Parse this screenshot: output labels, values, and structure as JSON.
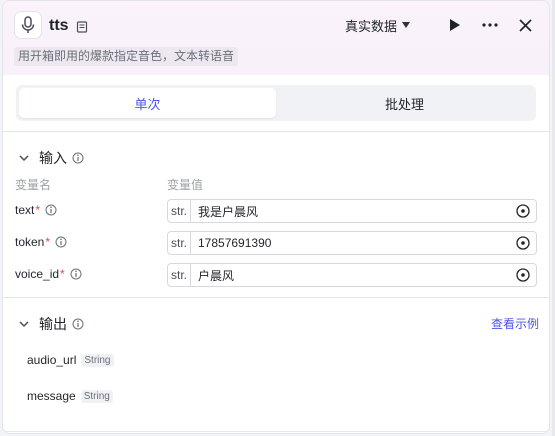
{
  "header": {
    "title": "tts",
    "description": "用开箱即用的爆款指定音色，文本转语音",
    "data_mode": "真实数据"
  },
  "tabs": [
    {
      "label": "单次",
      "active": true
    },
    {
      "label": "批处理",
      "active": false
    }
  ],
  "input_section": {
    "title": "输入",
    "col_name": "变量名",
    "col_value": "变量值",
    "rows": [
      {
        "name": "text",
        "required": "*",
        "type": "str.",
        "value": "我是户晨风"
      },
      {
        "name": "token",
        "required": "*",
        "type": "str.",
        "value": "17857691390"
      },
      {
        "name": "voice_id",
        "required": "*",
        "type": "str.",
        "value": "户晨风"
      }
    ]
  },
  "output_section": {
    "title": "输出",
    "view_example": "查看示例",
    "items": [
      {
        "name": "audio_url",
        "type": "String"
      },
      {
        "name": "message",
        "type": "String"
      }
    ]
  },
  "colors": {
    "accent": "#4d53e8",
    "required": "#e54545",
    "header_bg": "#fbf2fb"
  },
  "icons": {
    "app": "microphone-icon",
    "doc": "document-icon",
    "run": "play-icon",
    "more": "more-horizontal-icon",
    "close": "close-icon",
    "collapse": "chevron-down-icon",
    "info": "info-icon",
    "ref": "target-icon"
  }
}
